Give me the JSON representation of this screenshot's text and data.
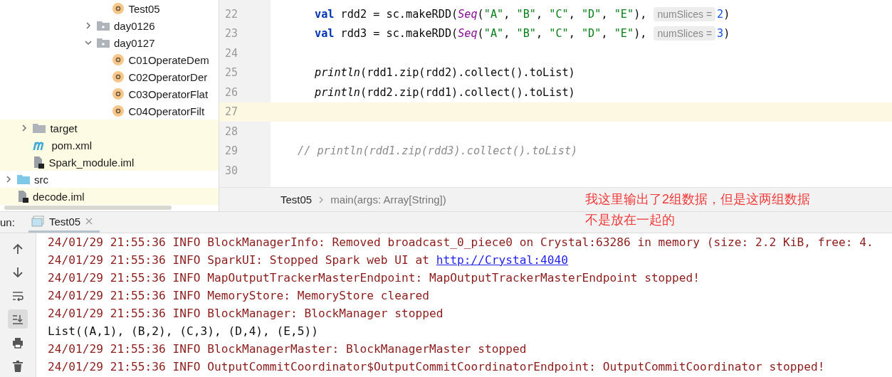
{
  "project_tree": [
    {
      "children": [
        {
          "children": [
            {
              "children": [
                {
                  "children": [
                    {
                      "children": [
                        {
                          "children": [
                            {
                              "label": "Test05",
                              "kind": "class",
                              "highlighted": false
                            }
                          ]
                        },
                        {
                          "label": "day0126",
                          "kind": "package",
                          "expanded": false,
                          "highlighted": false
                        },
                        {
                          "label": "day0127",
                          "kind": "package",
                          "expanded": true,
                          "highlighted": false,
                          "children": [
                            {
                              "label": "C01OperateDem",
                              "kind": "class",
                              "highlighted": false
                            },
                            {
                              "label": "C02OperatorDer",
                              "kind": "class",
                              "highlighted": false
                            },
                            {
                              "label": "C03OperatorFlat",
                              "kind": "class",
                              "highlighted": false
                            },
                            {
                              "label": "C04OperatorFilt",
                              "kind": "class",
                              "highlighted": false
                            }
                          ]
                        }
                      ]
                    }
                  ]
                }
              ]
            }
          ]
        },
        {
          "label": "target",
          "kind": "folder",
          "expanded": false,
          "highlighted": true
        },
        {
          "label": "pom.xml",
          "kind": "maven",
          "highlighted": true
        },
        {
          "label": "Spark_module.iml",
          "kind": "iml",
          "highlighted": true
        }
      ]
    },
    {
      "label": "src",
      "kind": "source_folder",
      "expanded": false,
      "highlighted": false
    },
    {
      "label": "decode.iml",
      "kind": "iml",
      "highlighted": true
    }
  ],
  "editor": {
    "lines": [
      {
        "number": "22",
        "current": false,
        "tokens": [
          {
            "kind": "keyword",
            "text": "val"
          },
          {
            "kind": "plain",
            "text": " rdd2 = sc.makeRDD("
          },
          {
            "kind": "type",
            "text": "Seq"
          },
          {
            "kind": "plain",
            "text": "("
          },
          {
            "kind": "string",
            "text": "\"A\""
          },
          {
            "kind": "plain",
            "text": ", "
          },
          {
            "kind": "string",
            "text": "\"B\""
          },
          {
            "kind": "plain",
            "text": ", "
          },
          {
            "kind": "string",
            "text": "\"C\""
          },
          {
            "kind": "plain",
            "text": ", "
          },
          {
            "kind": "string",
            "text": "\"D\""
          },
          {
            "kind": "plain",
            "text": ", "
          },
          {
            "kind": "string",
            "text": "\"E\""
          },
          {
            "kind": "plain",
            "text": "),"
          },
          {
            "kind": "hint",
            "text": "numSlices ="
          },
          {
            "kind": "number",
            "text": "2"
          },
          {
            "kind": "plain",
            "text": ")"
          }
        ]
      },
      {
        "number": "23",
        "current": false,
        "tokens": [
          {
            "kind": "keyword",
            "text": "val"
          },
          {
            "kind": "plain",
            "text": " rdd3 = sc.makeRDD("
          },
          {
            "kind": "type",
            "text": "Seq"
          },
          {
            "kind": "plain",
            "text": "("
          },
          {
            "kind": "string",
            "text": "\"A\""
          },
          {
            "kind": "plain",
            "text": ", "
          },
          {
            "kind": "string",
            "text": "\"B\""
          },
          {
            "kind": "plain",
            "text": ", "
          },
          {
            "kind": "string",
            "text": "\"C\""
          },
          {
            "kind": "plain",
            "text": ", "
          },
          {
            "kind": "string",
            "text": "\"D\""
          },
          {
            "kind": "plain",
            "text": ", "
          },
          {
            "kind": "string",
            "text": "\"E\""
          },
          {
            "kind": "plain",
            "text": "),"
          },
          {
            "kind": "hint",
            "text": "numSlices ="
          },
          {
            "kind": "number",
            "text": "3"
          },
          {
            "kind": "plain",
            "text": ")"
          }
        ]
      },
      {
        "number": "24",
        "current": false
      },
      {
        "number": "25",
        "current": false,
        "tokens": [
          {
            "kind": "call",
            "text": "println"
          },
          {
            "kind": "plain",
            "text": "(rdd1.zip(rdd2).collect().toList)"
          }
        ]
      },
      {
        "number": "26",
        "current": false,
        "tokens": [
          {
            "kind": "call",
            "text": "println"
          },
          {
            "kind": "plain",
            "text": "(rdd2.zip(rdd1).collect().toList)"
          }
        ]
      },
      {
        "number": "27",
        "current": true
      },
      {
        "number": "28",
        "current": false
      },
      {
        "number": "29",
        "current": false,
        "tokens": [
          {
            "kind": "comment",
            "text": "// println(rdd1.zip(rdd3).collect().toList)"
          }
        ]
      },
      {
        "number": "30",
        "current": false
      }
    ]
  },
  "breadcrumbs": [
    "Test05",
    "main(args: Array[String])"
  ],
  "annotation": [
    "我这里输出了2组数据，但是这两组数据",
    "不是放在一起的"
  ],
  "run_panel": {
    "label": "un:",
    "tabs": [
      {
        "label": "Test05",
        "selected": true
      }
    ],
    "toolbar": [
      {
        "kind": "up",
        "selected": false
      },
      {
        "kind": "down",
        "selected": false
      },
      {
        "kind": "wrap",
        "selected": false
      },
      {
        "kind": "scroll_end",
        "selected": true
      },
      {
        "kind": "print",
        "selected": false
      },
      {
        "kind": "trash",
        "selected": false
      }
    ],
    "console": [
      {
        "kind": "log",
        "text": "24/01/29 21:55:36 INFO BlockManagerInfo: Removed broadcast_0_piece0 on Crystal:63286 in memory (size: 2.2 KiB, free: 4."
      },
      {
        "kind": "log",
        "text": "24/01/29 21:55:36 INFO SparkUI: Stopped Spark web UI at ",
        "link": "http://Crystal:4040"
      },
      {
        "kind": "log",
        "text": "24/01/29 21:55:36 INFO MapOutputTrackerMasterEndpoint: MapOutputTrackerMasterEndpoint stopped!"
      },
      {
        "kind": "log",
        "text": "24/01/29 21:55:36 INFO MemoryStore: MemoryStore cleared"
      },
      {
        "kind": "log",
        "text": "24/01/29 21:55:36 INFO BlockManager: BlockManager stopped"
      },
      {
        "kind": "output",
        "text": "List((A,1), (B,2), (C,3), (D,4), (E,5))"
      },
      {
        "kind": "log",
        "text": "24/01/29 21:55:36 INFO BlockManagerMaster: BlockManagerMaster stopped"
      },
      {
        "kind": "log",
        "text": "24/01/29 21:55:36 INFO OutputCommitCoordinator$OutputCommitCoordinatorEndpoint: OutputCommitCoordinator stopped!"
      }
    ]
  }
}
